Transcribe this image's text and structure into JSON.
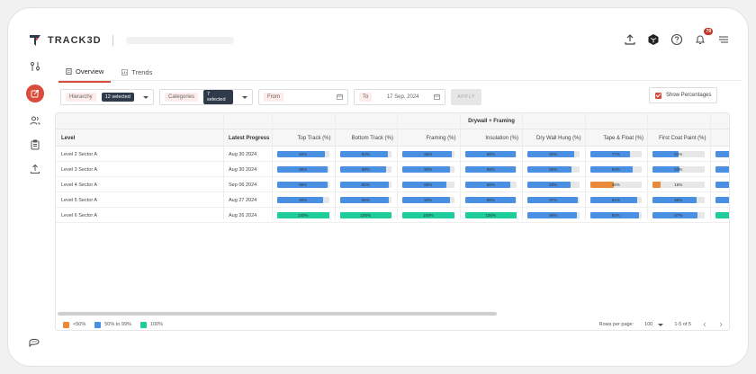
{
  "app": {
    "logo_text": "TRACK3D"
  },
  "topbar": {
    "notification_count": "79"
  },
  "tabs": [
    {
      "label": "Overview"
    },
    {
      "label": "Trends"
    }
  ],
  "filters": {
    "hierarchy": {
      "label": "Hierarchy",
      "chip": "12 selected"
    },
    "categories": {
      "label": "Categories",
      "chip": "7 selected"
    },
    "from": {
      "label": "From",
      "value": ""
    },
    "to": {
      "label": "To",
      "value": "17 Sep, 2024"
    },
    "apply_label": "APPLY"
  },
  "show_percentages": {
    "label": "Show Percentages",
    "checked": true
  },
  "table": {
    "group": "Drywall + Framing",
    "headers": {
      "level": "Level",
      "latest": "Latest Progress"
    },
    "columns": [
      "Top Track (%)",
      "Bottom Track (%)",
      "Framing (%)",
      "Insulation (%)",
      "Dry Wall Hung (%)",
      "Tape & Float (%)",
      "First Coat Paint (%)",
      "Me"
    ],
    "rows": [
      {
        "level": "Level 2 Sector A",
        "latest": "Aug 30 2024",
        "values": [
          92,
          93,
          95,
          98,
          90,
          77,
          51,
          null
        ]
      },
      {
        "level": "Level 3 Sector A",
        "latest": "Aug 30 2024",
        "values": [
          98,
          89,
          93,
          98,
          85,
          83,
          53,
          null
        ]
      },
      {
        "level": "Level 4 Sector A",
        "latest": "Sep 06 2024",
        "values": [
          98,
          95,
          86,
          88,
          83,
          46,
          16,
          null
        ]
      },
      {
        "level": "Level 5 Sector A",
        "latest": "Aug 27 2024",
        "values": [
          89,
          95,
          93,
          98,
          97,
          91,
          85,
          null
        ]
      },
      {
        "level": "Level 6 Sector A",
        "latest": "Aug 26 2024",
        "values": [
          100,
          100,
          100,
          100,
          96,
          94,
          87,
          null
        ]
      }
    ]
  },
  "legend": [
    {
      "label": "<50%",
      "color": "#e98a3a"
    },
    {
      "label": "50% to 99%",
      "color": "#4a90e2"
    },
    {
      "label": "100%",
      "color": "#1ecc9c"
    }
  ],
  "pager": {
    "rows_label": "Rows per page:",
    "rows_value": "100",
    "range": "1-5 of 5"
  },
  "colors": {
    "accent": "#d94b3a",
    "blue": "#4a90e2",
    "orange": "#e98a3a",
    "green": "#1ecc9c"
  }
}
